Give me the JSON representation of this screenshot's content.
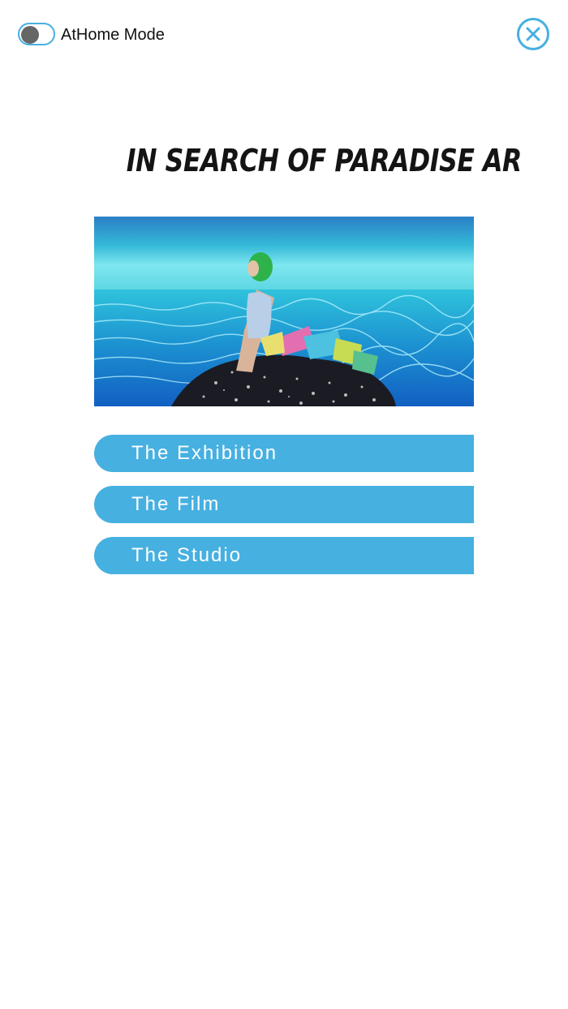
{
  "header": {
    "toggle_label": "AtHome Mode",
    "toggle_on": false
  },
  "title": "IN SEARCH OF PARADISE AR",
  "menu": {
    "items": [
      {
        "label": "The Exhibition"
      },
      {
        "label": "The Film"
      },
      {
        "label": "The Studio"
      }
    ]
  },
  "colors": {
    "accent": "#46b0e1",
    "knob": "#666666",
    "background": "#ffffff"
  }
}
